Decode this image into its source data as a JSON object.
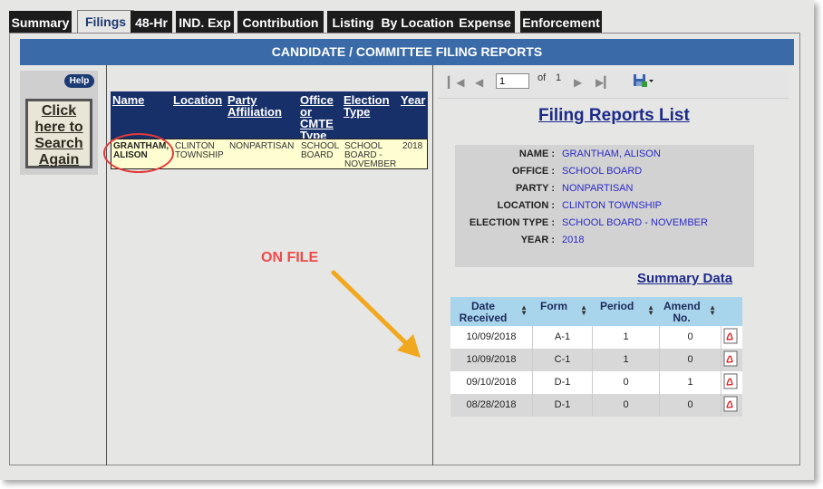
{
  "tabs": [
    "Summary",
    "Filings",
    "48-Hr",
    "IND. Exp",
    "Contribution",
    "Listing",
    "By Location",
    "Expense",
    "Enforcement"
  ],
  "header": {
    "title": "CANDIDATE / COMMITTEE FILING REPORTS"
  },
  "search_panel": {
    "help_label": "Help",
    "click_text": "Click here to Search Again"
  },
  "results_table": {
    "headers": {
      "name": "Name",
      "location": "Location",
      "party": "Party Affiliation",
      "office": "Office or CMTE Type",
      "election": "Election Type",
      "year": "Year"
    },
    "row": {
      "name": "GRANTHAM, ALISON",
      "location": "CLINTON TOWNSHIP",
      "party": "NONPARTISAN",
      "office": "SCHOOL BOARD",
      "election": "SCHOOL BOARD - NOVEMBER",
      "year": "2018"
    }
  },
  "annotation": {
    "on_file": "ON FILE"
  },
  "toolbar": {
    "page_value": "1",
    "of_label": "of",
    "total_pages": "1"
  },
  "report": {
    "title": "Filing Reports List",
    "info": [
      {
        "label": "NAME :",
        "value": "GRANTHAM, ALISON"
      },
      {
        "label": "OFFICE :",
        "value": "SCHOOL BOARD"
      },
      {
        "label": "PARTY :",
        "value": "NONPARTISAN"
      },
      {
        "label": "LOCATION :",
        "value": "CLINTON TOWNSHIP"
      },
      {
        "label": "ELECTION TYPE :",
        "value": "SCHOOL BOARD - NOVEMBER"
      },
      {
        "label": "YEAR :",
        "value": "2018"
      }
    ],
    "summary_link": "Summary Data",
    "columns": [
      "Date Received",
      "Form",
      "Period",
      "Amend No."
    ],
    "rows": [
      {
        "date": "10/09/2018",
        "form": "A-1",
        "period": "1",
        "amend": "0"
      },
      {
        "date": "10/09/2018",
        "form": "C-1",
        "period": "1",
        "amend": "0"
      },
      {
        "date": "09/10/2018",
        "form": "D-1",
        "period": "0",
        "amend": "1"
      },
      {
        "date": "08/28/2018",
        "form": "D-1",
        "period": "0",
        "amend": "0"
      }
    ]
  },
  "colors": {
    "header_bar": "#3a6aa8",
    "table_head": "#17306a",
    "accent_red": "#e23a3a",
    "arrow": "#f2a81e",
    "col_header": "#a8d4ec"
  }
}
